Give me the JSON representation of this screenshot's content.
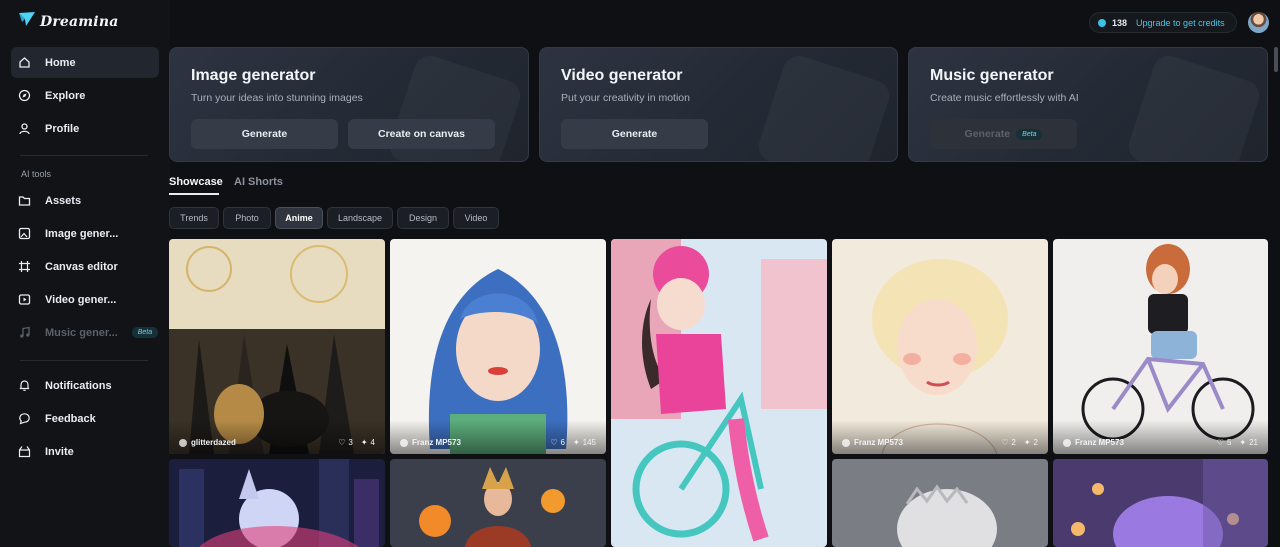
{
  "brand": {
    "name": "Dreamina"
  },
  "header": {
    "credits_count": "138",
    "credits_cta": "Upgrade to get credits",
    "accent_color": "#39c3e6"
  },
  "sidebar": {
    "items": [
      {
        "label": "Home",
        "icon": "home-icon"
      },
      {
        "label": "Explore",
        "icon": "compass-icon"
      },
      {
        "label": "Profile",
        "icon": "user-icon"
      }
    ],
    "section_label": "AI tools",
    "tools": [
      {
        "label": "Assets",
        "icon": "folder-icon"
      },
      {
        "label": "Image gener...",
        "icon": "image-icon"
      },
      {
        "label": "Canvas editor",
        "icon": "canvas-icon"
      },
      {
        "label": "Video gener...",
        "icon": "video-icon"
      },
      {
        "label": "Music gener...",
        "icon": "music-icon",
        "badge": "Beta"
      }
    ],
    "bottom": [
      {
        "label": "Notifications",
        "icon": "bell-icon"
      },
      {
        "label": "Feedback",
        "icon": "chat-icon"
      },
      {
        "label": "Invite",
        "icon": "invite-icon"
      }
    ]
  },
  "generators": [
    {
      "title": "Image generator",
      "subtitle": "Turn your ideas into stunning images",
      "buttons": [
        "Generate",
        "Create on canvas"
      ]
    },
    {
      "title": "Video generator",
      "subtitle": "Put your creativity in motion",
      "buttons": [
        "Generate"
      ]
    },
    {
      "title": "Music generator",
      "subtitle": "Create music effortlessly with AI",
      "buttons": [
        "Generate"
      ],
      "badge": "Beta"
    }
  ],
  "tabs": [
    "Showcase",
    "AI Shorts"
  ],
  "filters": [
    "Trends",
    "Photo",
    "Anime",
    "Landscape",
    "Design",
    "Video"
  ],
  "selected_filter": "Anime",
  "gallery": [
    {
      "author": "glitterdazed",
      "likes": "3",
      "remixes": "4"
    },
    {
      "author": "Franz MP573",
      "likes": "6",
      "remixes": "145"
    },
    {
      "author": "",
      "likes": "",
      "remixes": ""
    },
    {
      "author": "Franz MP573",
      "likes": "2",
      "remixes": "2"
    },
    {
      "author": "Franz MP573",
      "likes": "5",
      "remixes": "21"
    }
  ]
}
